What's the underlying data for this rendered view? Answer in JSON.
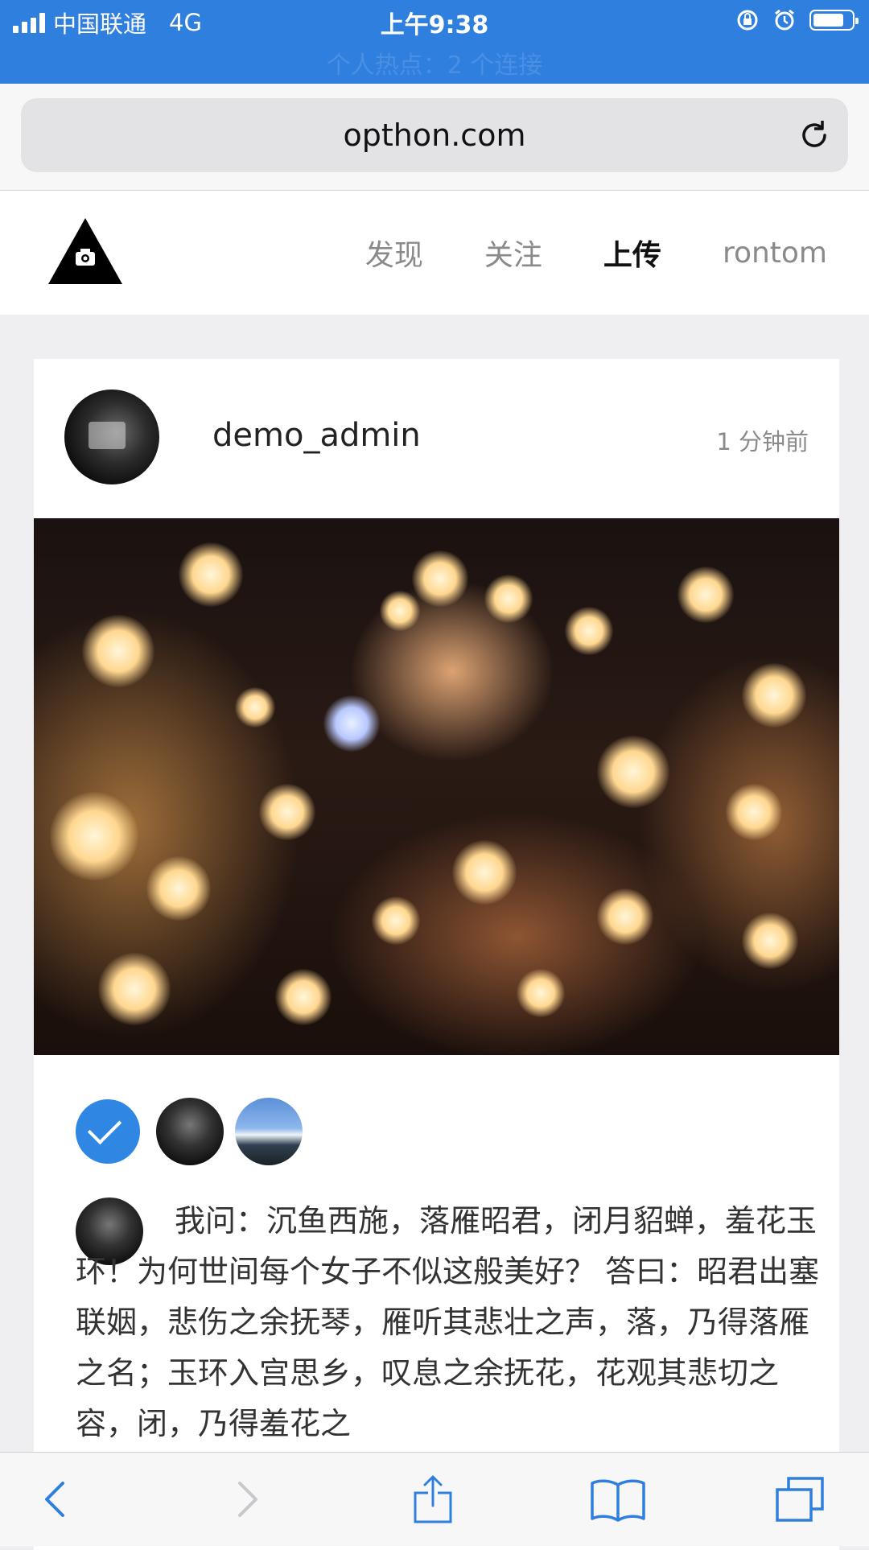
{
  "status_bar": {
    "carrier": "中国联通",
    "network": "4G",
    "time": "上午9:38",
    "hotspot": "个人热点：2 个连接",
    "battery_level": 0.8
  },
  "browser": {
    "url": "opthon.com",
    "reload_icon": "reload-icon"
  },
  "site_nav": {
    "logo_icon": "camera-triangle-logo",
    "items": [
      {
        "label": "发现",
        "active": false
      },
      {
        "label": "关注",
        "active": false
      },
      {
        "label": "上传",
        "active": true
      },
      {
        "label": "rontom",
        "active": false
      }
    ]
  },
  "post": {
    "username": "demo_admin",
    "time_ago": "1 分钟前",
    "caption": "我问：沉鱼西施，落雁昭君，闭月貂蝉，羞花玉环！为何世间每个女子不似这般美好？ 答曰：昭君出塞联姻，悲伤之余抚琴，雁听其悲壮之声，落，乃得落雁之名；玉环入宫思乡，叹息之余抚花，花观其悲切之容，闭，乃得羞花之"
  },
  "toolbar": {
    "icons": [
      "back-icon",
      "forward-icon",
      "share-icon",
      "bookmarks-icon",
      "tabs-icon"
    ]
  },
  "colors": {
    "status_bar": "#2f7fdf",
    "like_check": "#2f86e3"
  }
}
